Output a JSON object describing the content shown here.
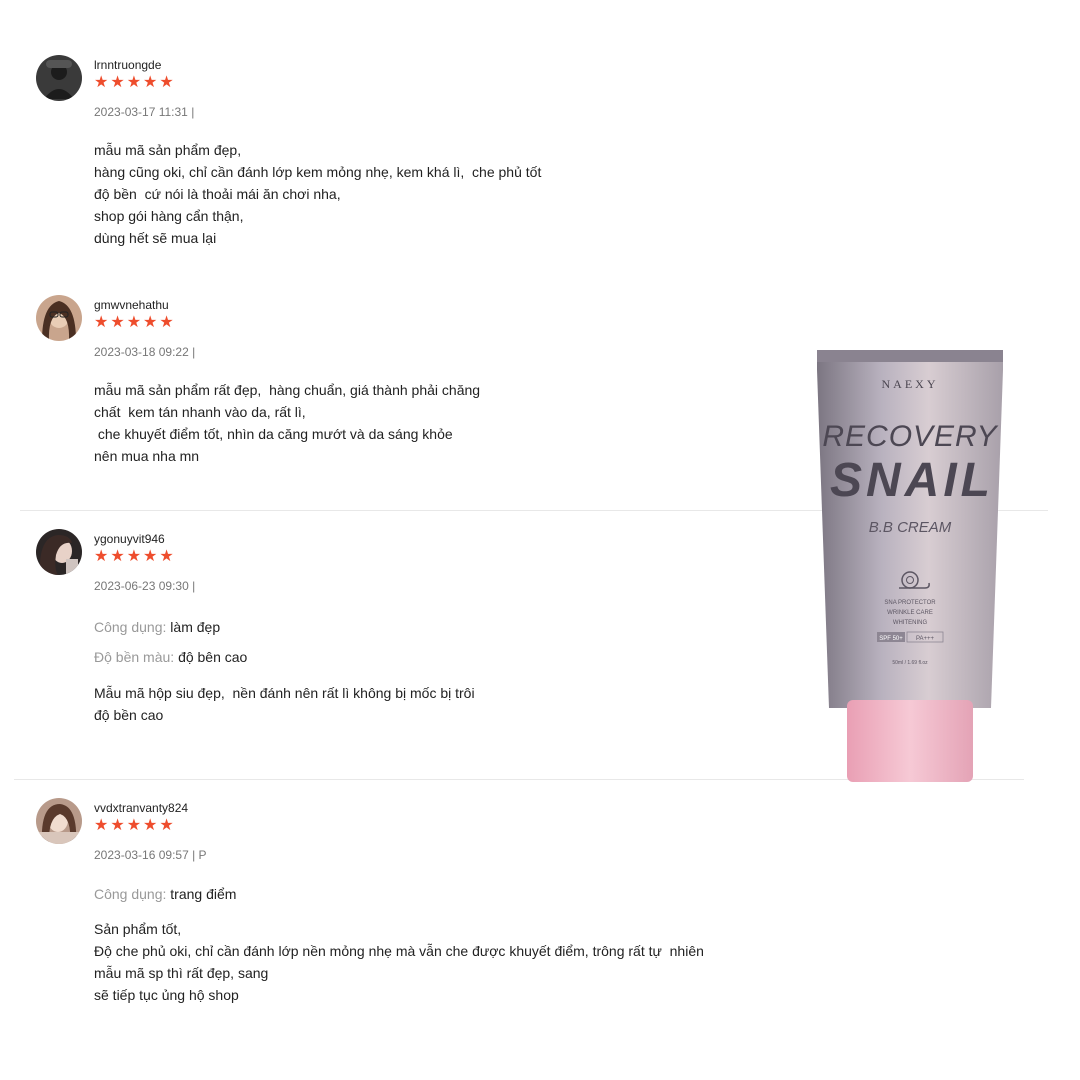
{
  "reviews": [
    {
      "username": "lrnntruongde",
      "stars": "★★★★★",
      "meta": "2023-03-17 11:31 |",
      "attributes": [],
      "body": "mẫu mã sản phẩm đẹp,\nhàng cũng oki, chỉ cần đánh lớp kem mỏng nhẹ, kem khá lì,  che phủ tốt\nđộ bền  cứ nói là thoải mái ăn chơi nha,\nshop gói hàng cẩn thận,\ndùng hết sẽ mua lại"
    },
    {
      "username": "gmwvnehathu",
      "stars": "★★★★★",
      "meta": "2023-03-18 09:22 |",
      "attributes": [],
      "body": "mẫu mã sản phẩm rất đẹp,  hàng chuẩn, giá thành phải chăng\nchất  kem tán nhanh vào da, rất lì,\n che khuyết điểm tốt, nhìn da căng mướt và da sáng khỏe\nnên mua nha mn"
    },
    {
      "username": "ygonuyvit946",
      "stars": "★★★★★",
      "meta": "2023-06-23 09:30 |",
      "attributes": [
        {
          "label": "Công dụng:",
          "value": "làm đẹp"
        },
        {
          "label": "Độ bền màu:",
          "value": "độ bên cao"
        }
      ],
      "body": "Mẫu mã hộp siu đẹp,  nền đánh nên rất lì không bị mốc bị trôi\nđộ bền cao"
    },
    {
      "username": "vvdxtranvanty824",
      "stars": "★★★★★",
      "meta": "2023-03-16 09:57 | P",
      "attributes": [
        {
          "label": "Công dụng:",
          "value": "trang điểm"
        }
      ],
      "body": "Sản phẩm tốt,\nĐộ che phủ oki, chỉ cần đánh lớp nền mỏng nhẹ mà vẫn che được khuyết điểm, trông rất tự  nhiên\nmẫu mã sp thì rất đẹp, sang\nsẽ tiếp tục ủng hộ shop"
    }
  ],
  "product": {
    "brand": "NAEXY",
    "line1": "RECOVERY",
    "line2": "SNAIL",
    "line3": "B.B CREAM",
    "small1": "SNA PROTECTOR",
    "small2": "WRINKLE CARE",
    "small3": "WHITENING",
    "spf": "SPF 50+",
    "pa": "PA+++",
    "volume": "50ml / 1.69 fl.oz"
  },
  "colors": {
    "star": "#ee4d2d",
    "muted_text": "#777777",
    "label_text": "#999999",
    "divider": "#e8e8e8",
    "tube_cap": "#f2b8c6"
  }
}
